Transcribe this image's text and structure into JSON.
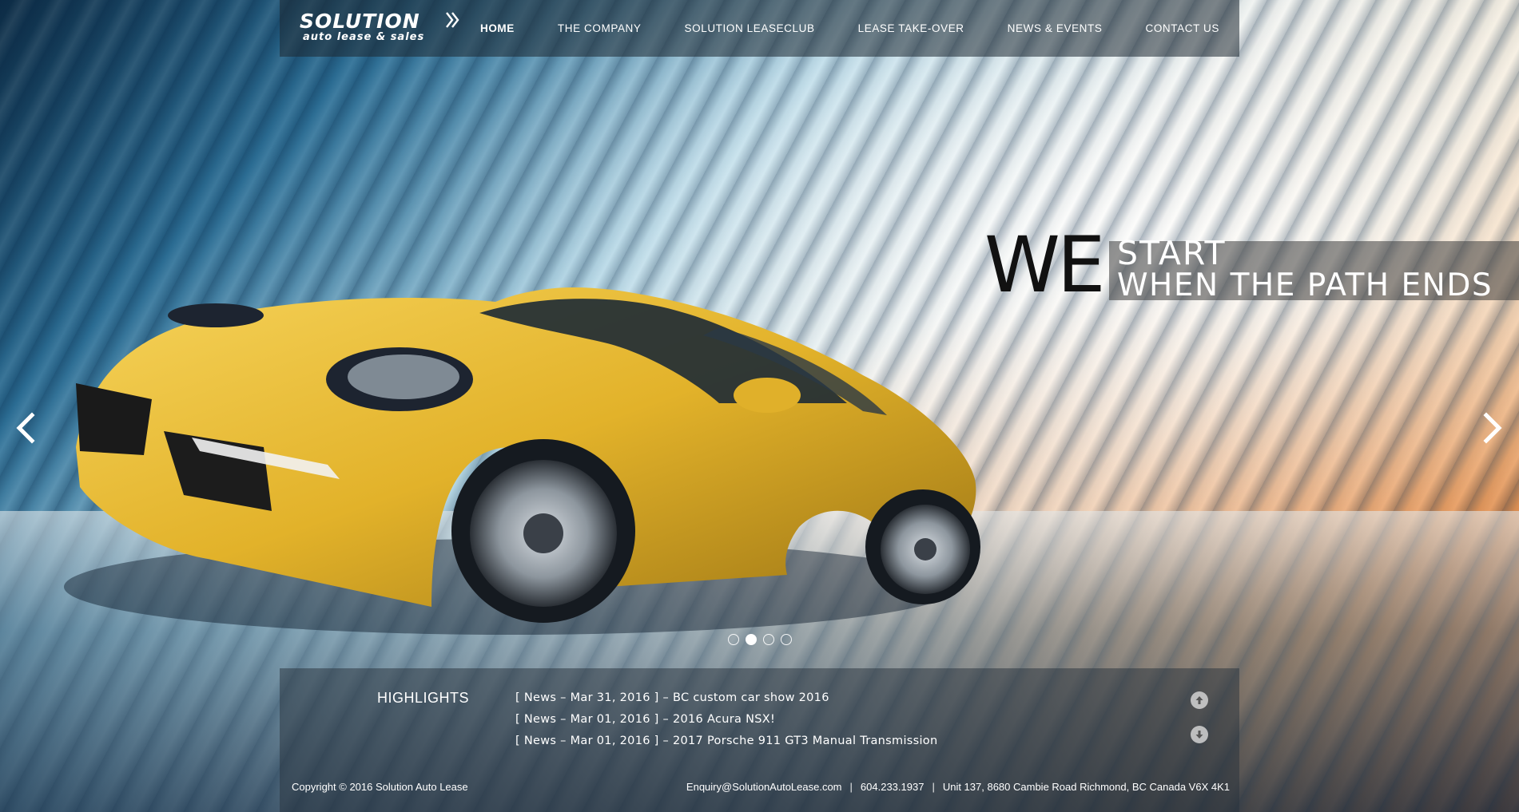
{
  "brand": {
    "logo_main": "SOLUTION",
    "logo_sub": "auto lease & sales"
  },
  "nav": {
    "items": [
      {
        "label": "HOME",
        "active": true
      },
      {
        "label": "THE COMPANY",
        "active": false
      },
      {
        "label": "SOLUTION LEASECLUB",
        "active": false
      },
      {
        "label": "LEASE TAKE-OVER",
        "active": false
      },
      {
        "label": "NEWS & EVENTS",
        "active": false
      },
      {
        "label": "CONTACT US",
        "active": false
      }
    ]
  },
  "hero": {
    "tagline_big": "WE",
    "tagline_line1": "START",
    "tagline_line2": "WHEN THE PATH ENDS",
    "slides_total": 4,
    "active_slide": 2
  },
  "highlights": {
    "title": "HIGHLIGHTS",
    "items": [
      "[ News – Mar 31, 2016 ] – BC custom car show 2016",
      "[ News – Mar 01, 2016 ] – 2016 Acura NSX!",
      "[ News – Mar 01, 2016 ] – 2017 Porsche 911 GT3 Manual Transmission"
    ]
  },
  "footer": {
    "copyright": "Copyright © 2016 Solution Auto Lease",
    "email": "Enquiry@SolutionAutoLease.com",
    "phone": "604.233.1937",
    "address": "Unit 137, 8680 Cambie Road Richmond, BC Canada V6X 4K1",
    "separator": "|"
  },
  "icons": {
    "prev": "chevron-left-icon",
    "next": "chevron-right-icon",
    "scroll_up": "arrow-up-icon",
    "scroll_down": "arrow-down-icon"
  },
  "colors": {
    "car": "#e8b830",
    "overlay": "#2a3440",
    "tagline_dark": "#111111"
  }
}
